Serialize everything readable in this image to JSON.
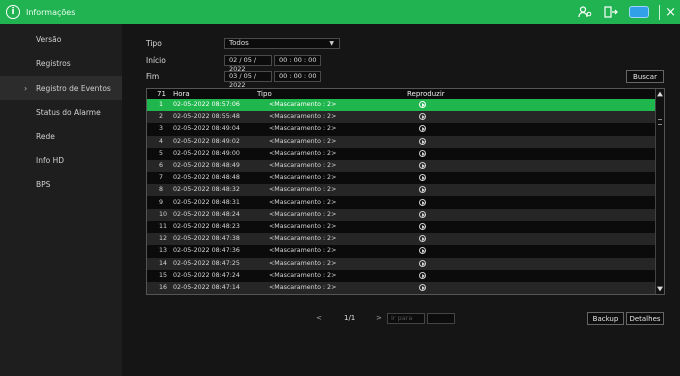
{
  "window": {
    "title": "Informações"
  },
  "sidebar": {
    "items": [
      {
        "label": "Versão"
      },
      {
        "label": "Registros"
      },
      {
        "label": "Registro de Eventos"
      },
      {
        "label": "Status do Alarme"
      },
      {
        "label": "Rede"
      },
      {
        "label": "Info HD"
      },
      {
        "label": "BPS"
      }
    ]
  },
  "filter": {
    "type_label": "Tipo",
    "type_value": "Todos",
    "start_label": "Início",
    "start_date": "02 / 05 / 2022",
    "start_time": "00 : 00 : 00",
    "end_label": "Fim",
    "end_date": "03 / 05 / 2022",
    "end_time": "00 : 00 : 00",
    "search_label": "Buscar"
  },
  "table": {
    "count": "71",
    "headers": {
      "hour": "Hora",
      "type": "Tipo",
      "play": "Reproduzir"
    },
    "rows": [
      {
        "n": "1",
        "time": "02-05-2022 08:57:06",
        "type": "<Mascaramento : 2>"
      },
      {
        "n": "2",
        "time": "02-05-2022 08:55:48",
        "type": "<Mascaramento : 2>"
      },
      {
        "n": "3",
        "time": "02-05-2022 08:49:04",
        "type": "<Mascaramento : 2>"
      },
      {
        "n": "4",
        "time": "02-05-2022 08:49:02",
        "type": "<Mascaramento : 2>"
      },
      {
        "n": "5",
        "time": "02-05-2022 08:49:00",
        "type": "<Mascaramento : 2>"
      },
      {
        "n": "6",
        "time": "02-05-2022 08:48:49",
        "type": "<Mascaramento : 2>"
      },
      {
        "n": "7",
        "time": "02-05-2022 08:48:48",
        "type": "<Mascaramento : 2>"
      },
      {
        "n": "8",
        "time": "02-05-2022 08:48:32",
        "type": "<Mascaramento : 2>"
      },
      {
        "n": "9",
        "time": "02-05-2022 08:48:31",
        "type": "<Mascaramento : 2>"
      },
      {
        "n": "10",
        "time": "02-05-2022 08:48:24",
        "type": "<Mascaramento : 2>"
      },
      {
        "n": "11",
        "time": "02-05-2022 08:48:23",
        "type": "<Mascaramento : 2>"
      },
      {
        "n": "12",
        "time": "02-05-2022 08:47:38",
        "type": "<Mascaramento : 2>"
      },
      {
        "n": "13",
        "time": "02-05-2022 08:47:36",
        "type": "<Mascaramento : 2>"
      },
      {
        "n": "14",
        "time": "02-05-2022 08:47:25",
        "type": "<Mascaramento : 2>"
      },
      {
        "n": "15",
        "time": "02-05-2022 08:47:24",
        "type": "<Mascaramento : 2>"
      },
      {
        "n": "16",
        "time": "02-05-2022 08:47:14",
        "type": "<Mascaramento : 2>"
      }
    ]
  },
  "pager": {
    "prev": "<",
    "page": "1/1",
    "next": ">",
    "goto_placeholder": "Ir para",
    "go": ""
  },
  "actions": {
    "backup": "Backup",
    "details": "Detalhes"
  },
  "colors": {
    "accent": "#21b352"
  }
}
